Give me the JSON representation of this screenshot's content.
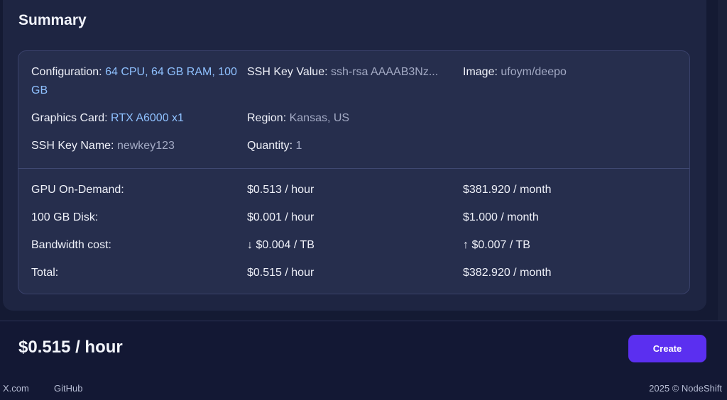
{
  "summary": {
    "title": "Summary",
    "config": {
      "configuration_label": "Configuration:",
      "configuration_value": "64 CPU, 64 GB RAM, 100 GB",
      "ssh_key_value_label": "SSH Key Value:",
      "ssh_key_value_value": "ssh-rsa AAAAB3Nz...",
      "image_label": "Image:",
      "image_value": "ufoym/deepo",
      "graphics_card_label": "Graphics Card:",
      "graphics_card_value": "RTX A6000 x1",
      "region_label": "Region:",
      "region_value": "Kansas, US",
      "ssh_key_name_label": "SSH Key Name:",
      "ssh_key_name_value": "newkey123",
      "quantity_label": "Quantity:",
      "quantity_value": "1"
    },
    "pricing": [
      {
        "label": "GPU On-Demand:",
        "hourly": "$0.513 / hour",
        "monthly": "$381.920 / month"
      },
      {
        "label": "100 GB Disk:",
        "hourly": "$0.001 / hour",
        "monthly": "$1.000 / month"
      },
      {
        "label": "Bandwidth cost:",
        "hourly": "↓ $0.004 / TB",
        "monthly": "↑ $0.007 / TB"
      },
      {
        "label": "Total:",
        "hourly": "$0.515 / hour",
        "monthly": "$382.920 / month"
      }
    ]
  },
  "footer": {
    "total_price": "$0.515 / hour",
    "create_label": "Create",
    "links": [
      "X.com",
      "GitHub"
    ],
    "copyright": "2025 © NodeShift"
  },
  "colors": {
    "accent": "#5b2ff0",
    "value_blue": "#8fc1ff",
    "background": "#141a33"
  }
}
